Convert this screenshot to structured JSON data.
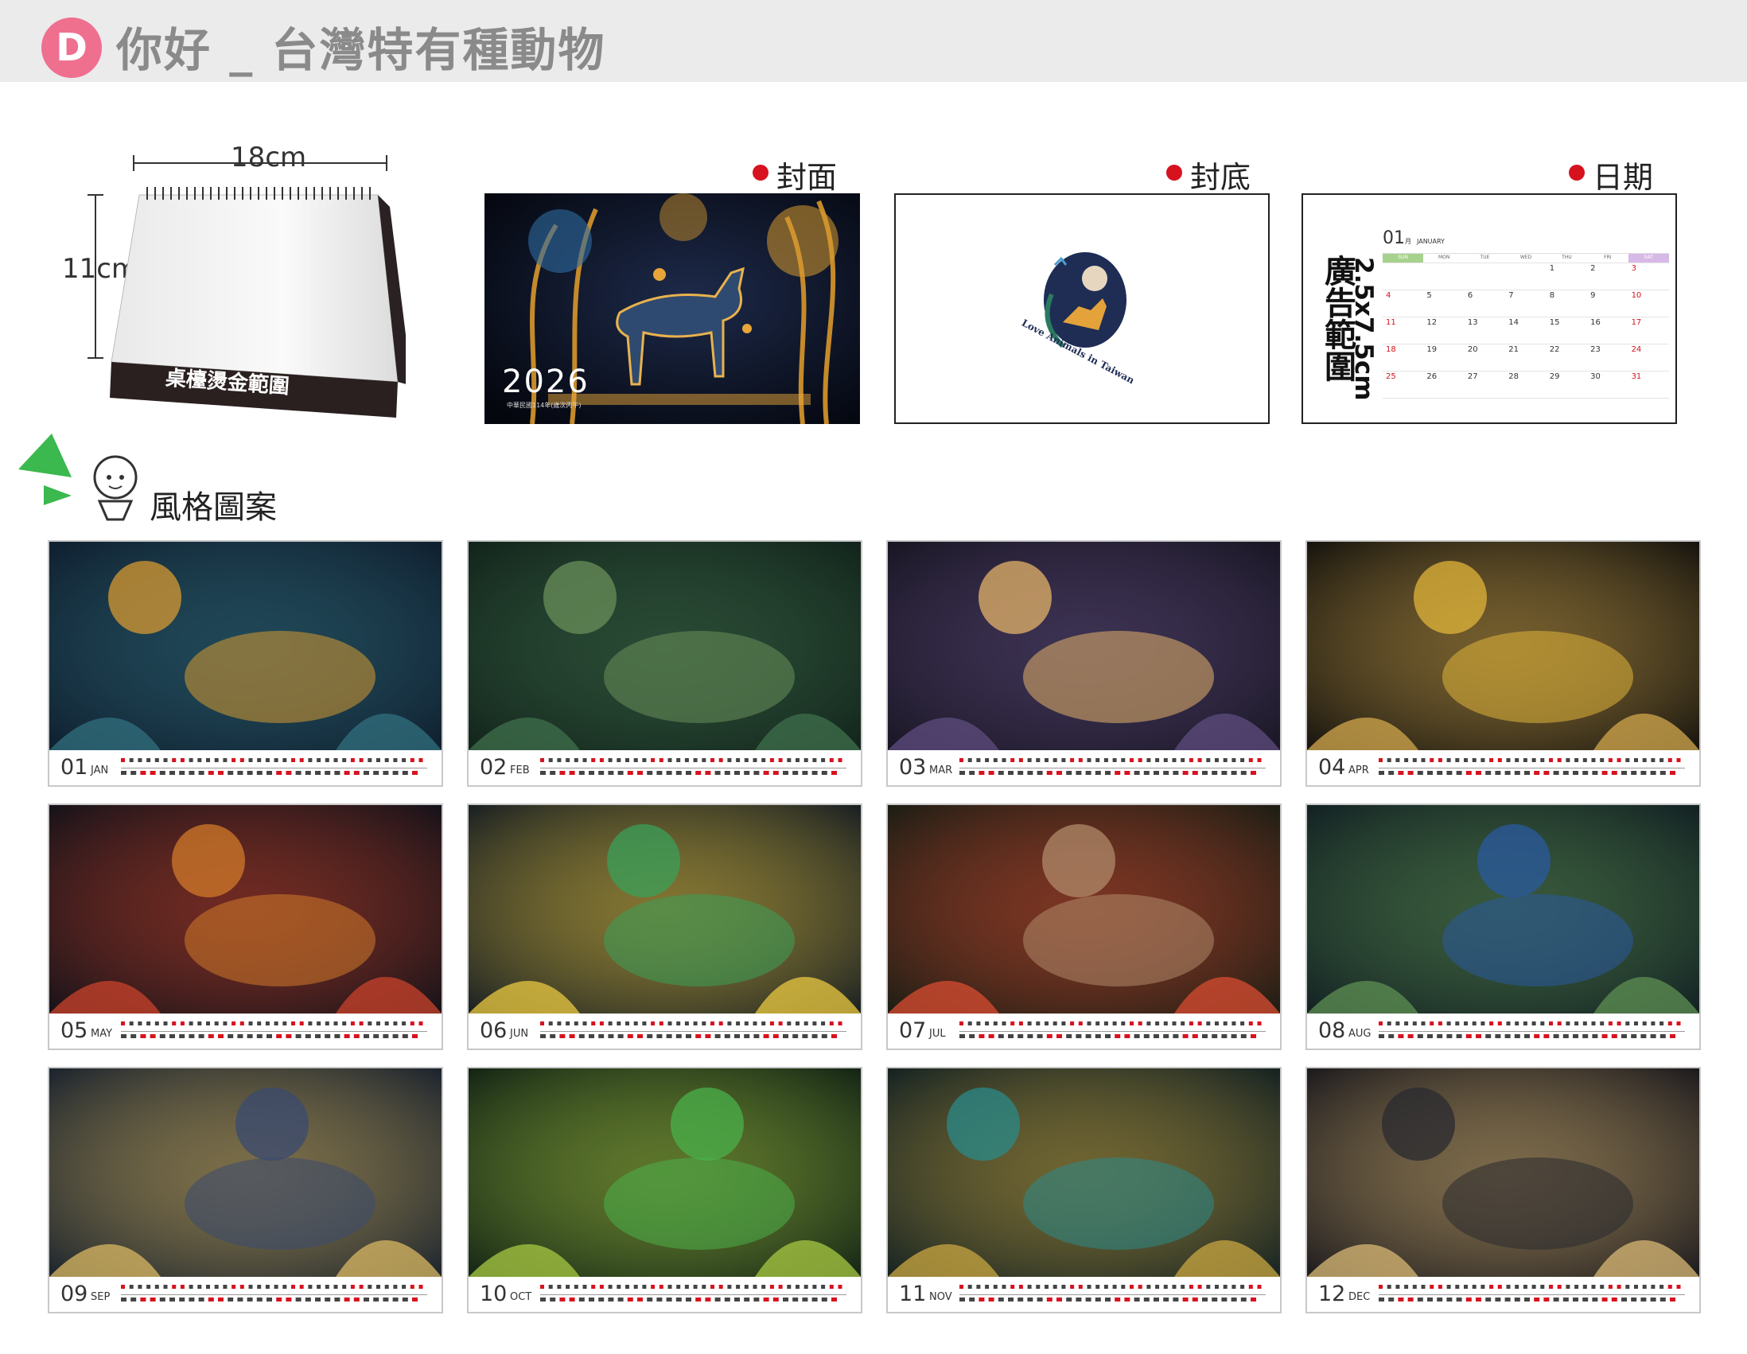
{
  "header": {
    "badge": "D",
    "title": "你好 _ 台灣特有種動物"
  },
  "desk_calendar": {
    "width_label": "18cm",
    "height_label": "11cm",
    "base_label": "桌檯燙金範圍"
  },
  "sections": {
    "cover_label": "封面",
    "back_label": "封底",
    "date_label": "日期"
  },
  "cover": {
    "year": "2026",
    "subtitle": "中華民國114年(歲次丙午)"
  },
  "back": {
    "logo_text": "Love Animals in Taiwan"
  },
  "date_page": {
    "ad_area": "廣告範圍",
    "ad_size": "2.5x7.5cm",
    "month_num": "01",
    "month_zh": "月",
    "month_en": "JANUARY",
    "weekdays": [
      "SUN",
      "MON",
      "TUE",
      "WED",
      "THU",
      "FRI",
      "SAT"
    ],
    "days": [
      "",
      "",
      "",
      "",
      "1",
      "2",
      "3",
      "4",
      "5",
      "6",
      "7",
      "8",
      "9",
      "10",
      "11",
      "12",
      "13",
      "14",
      "15",
      "16",
      "17",
      "18",
      "19",
      "20",
      "21",
      "22",
      "23",
      "24",
      "25",
      "26",
      "27",
      "28",
      "29",
      "30",
      "31"
    ]
  },
  "style_section": {
    "title": "風格圖案"
  },
  "months": [
    {
      "num": "01",
      "name": "JAN"
    },
    {
      "num": "02",
      "name": "FEB"
    },
    {
      "num": "03",
      "name": "MAR"
    },
    {
      "num": "04",
      "name": "APR"
    },
    {
      "num": "05",
      "name": "MAY"
    },
    {
      "num": "06",
      "name": "JUN"
    },
    {
      "num": "07",
      "name": "JUL"
    },
    {
      "num": "08",
      "name": "AUG"
    },
    {
      "num": "09",
      "name": "SEP"
    },
    {
      "num": "10",
      "name": "OCT"
    },
    {
      "num": "11",
      "name": "NOV"
    },
    {
      "num": "12",
      "name": "DEC"
    }
  ],
  "colors": {
    "badge": "#ef6f8f",
    "accent_red": "#d7121f",
    "sunday_green": "#a7d28d",
    "saturday_purple": "#d7b9e8"
  }
}
